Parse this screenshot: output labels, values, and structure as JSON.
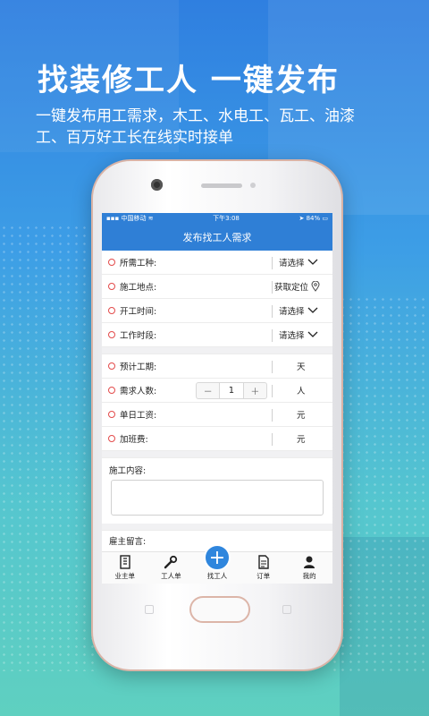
{
  "promo": {
    "headline": "找装修工人  一键发布",
    "subline": "一键发布用工需求，木工、水电工、瓦工、油漆工、百万好工长在线实时接单"
  },
  "status": {
    "carrier": "中国移动",
    "time": "下午3:08",
    "battery": "84%"
  },
  "page_title": "发布找工人需求",
  "form": {
    "worker_type": {
      "label": "所需工种:",
      "value": "请选择"
    },
    "location": {
      "label": "施工地点:",
      "value": "获取定位"
    },
    "start_time": {
      "label": "开工时间:",
      "value": "请选择"
    },
    "work_period": {
      "label": "工作时段:",
      "value": "请选择"
    },
    "duration": {
      "label": "预计工期:",
      "unit": "天"
    },
    "headcount": {
      "label": "需求人数:",
      "minus": "－",
      "value": "1",
      "plus": "＋",
      "unit": "人"
    },
    "daily_wage": {
      "label": "单日工资:",
      "unit": "元"
    },
    "overtime_fee": {
      "label": "加班费:",
      "unit": "元"
    },
    "content_label": "施工内容:",
    "message_label": "雇主留言:"
  },
  "tabs": [
    "业主单",
    "工人单",
    "找工人",
    "订单",
    "我的"
  ],
  "colors": {
    "primary": "#2f7fd6",
    "required": "#e34b4b"
  }
}
